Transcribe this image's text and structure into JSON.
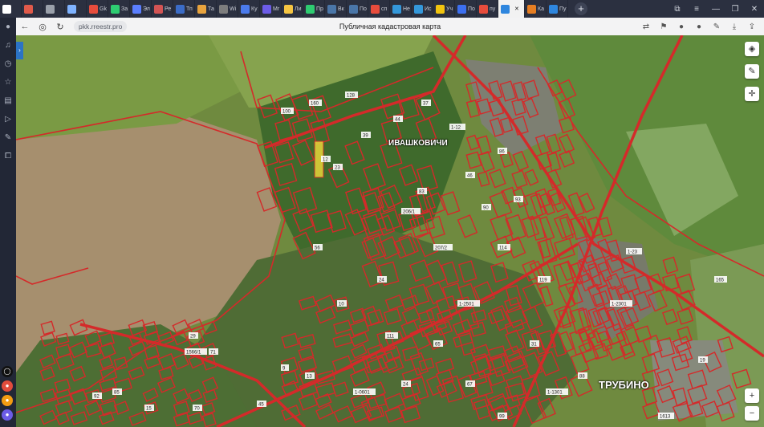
{
  "tabs": [
    {
      "label": "",
      "icon": "vk-icon",
      "color": "#ffffff"
    },
    {
      "label": "",
      "icon": "copy-icon",
      "color": "#e05a4a"
    },
    {
      "label": "",
      "icon": "grid-icon",
      "color": "#9aa0aa"
    },
    {
      "label": "",
      "icon": "chat-icon",
      "color": "#7fb3ff"
    },
    {
      "label": "Gk",
      "icon": "g-icon",
      "color": "#e74c3c"
    },
    {
      "label": "За",
      "icon": "doc-icon",
      "color": "#2ecc71"
    },
    {
      "label": "Эл",
      "icon": "mail-icon",
      "color": "#5b7fff"
    },
    {
      "label": "Ре",
      "icon": "bank-icon",
      "color": "#d35454"
    },
    {
      "label": "Тп",
      "icon": "line-icon",
      "color": "#3b6cc7"
    },
    {
      "label": "Та",
      "icon": "tag-icon",
      "color": "#e8a33d"
    },
    {
      "label": "Wi",
      "icon": "wiki-icon",
      "color": "#7d7d7d"
    },
    {
      "label": "Ку",
      "icon": "k-icon",
      "color": "#4b7bec"
    },
    {
      "label": "Mr",
      "icon": "m-icon",
      "color": "#6c5ce7"
    },
    {
      "label": "Ли",
      "icon": "doc-icon",
      "color": "#f5c542"
    },
    {
      "label": "Пр",
      "icon": "p-icon",
      "color": "#2ecc71"
    },
    {
      "label": "Вк",
      "icon": "vk-icon",
      "color": "#4a76a8"
    },
    {
      "label": "По",
      "icon": "vk-icon",
      "color": "#4a76a8"
    },
    {
      "label": "сп",
      "icon": "y-icon",
      "color": "#e74c3c"
    },
    {
      "label": "Не",
      "icon": "kc-icon",
      "color": "#3498db"
    },
    {
      "label": "Ис",
      "icon": "kc-icon",
      "color": "#3498db"
    },
    {
      "label": "Уч",
      "icon": "at-icon",
      "color": "#f1c40f"
    },
    {
      "label": "По",
      "icon": "mail-icon",
      "color": "#3c6ff0"
    },
    {
      "label": "пу",
      "icon": "y-icon",
      "color": "#e74c3c"
    },
    {
      "label": "",
      "icon": "map-icon",
      "color": "#2e86de",
      "active": true
    },
    {
      "label": "Ка",
      "icon": "map-icon",
      "color": "#e67e22"
    },
    {
      "label": "Пу",
      "icon": "map-icon",
      "color": "#2e86de"
    }
  ],
  "address": {
    "url": "pkk.rreestr.pro",
    "page_title": "Публичная кадастровая карта"
  },
  "map": {
    "places": [
      "ИВАШКОВИЧИ",
      "ТРУБИНО"
    ],
    "parcel_labels": [
      "100",
      "160",
      "128",
      "44",
      "37",
      "12",
      "23",
      "39",
      "1-12",
      "46",
      "86",
      "93",
      "90",
      "83",
      "207/2",
      "206/1",
      "114",
      "119",
      "1-23",
      "1-2301",
      "165",
      "19",
      "29",
      "1566/1",
      "71",
      "92",
      "85",
      "15",
      "70",
      "45",
      "13",
      "1-0601",
      "24",
      "65",
      "67",
      "99",
      "31",
      "88",
      "1613",
      "1-1301",
      "24",
      "1-2501",
      "56",
      "10",
      "9",
      "111"
    ],
    "colors": {
      "boundary": "#d42a2a",
      "highlight": "#e8d53a"
    }
  }
}
